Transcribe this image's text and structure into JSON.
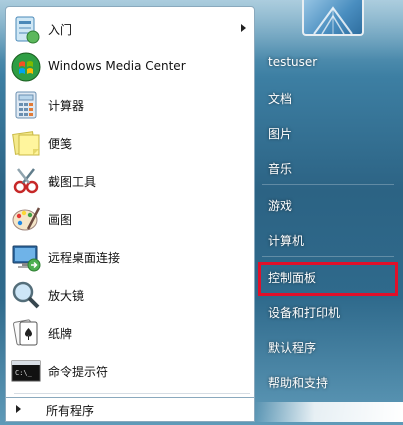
{
  "left_menu": {
    "items": [
      {
        "label": "入门",
        "icon": "getting-started-icon",
        "has_submenu": true
      },
      {
        "label": "Windows Media Center",
        "icon": "windows-media-center-icon"
      },
      {
        "label": "计算器",
        "icon": "calculator-icon"
      },
      {
        "label": "便笺",
        "icon": "sticky-notes-icon"
      },
      {
        "label": "截图工具",
        "icon": "snipping-tool-icon"
      },
      {
        "label": "画图",
        "icon": "paint-icon"
      },
      {
        "label": "远程桌面连接",
        "icon": "remote-desktop-icon"
      },
      {
        "label": "放大镜",
        "icon": "magnifier-icon"
      },
      {
        "label": "纸牌",
        "icon": "solitaire-icon"
      },
      {
        "label": "命令提示符",
        "icon": "command-prompt-icon"
      }
    ],
    "all_programs": "所有程序"
  },
  "right_menu": {
    "user": "testuser",
    "items": [
      "文档",
      "图片",
      "音乐",
      "游戏",
      "计算机",
      "控制面板",
      "设备和打印机",
      "默认程序",
      "帮助和支持"
    ],
    "highlighted": "控制面板",
    "highlight_color": "#e0102a"
  }
}
